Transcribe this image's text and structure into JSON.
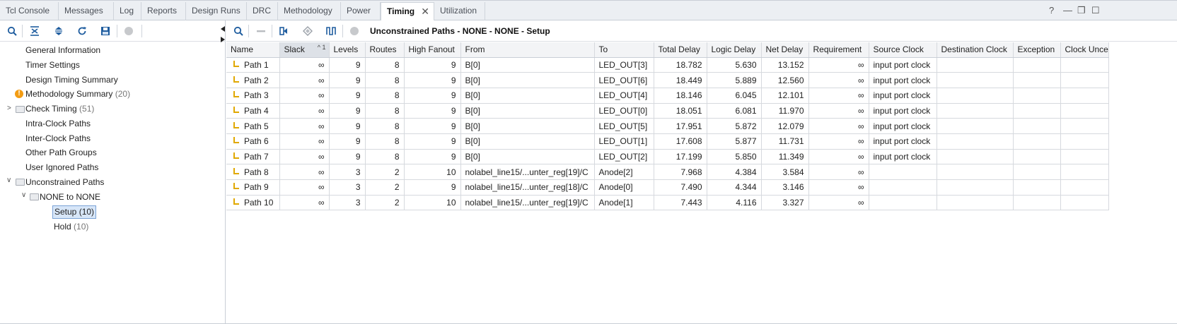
{
  "tabs": [
    {
      "label": "Tcl Console"
    },
    {
      "label": "Messages"
    },
    {
      "label": "Log"
    },
    {
      "label": "Reports"
    },
    {
      "label": "Design Runs"
    },
    {
      "label": "DRC"
    },
    {
      "label": "Methodology"
    },
    {
      "label": "Power"
    },
    {
      "label": "Timing"
    },
    {
      "label": "Utilization"
    }
  ],
  "active_tab": "Timing",
  "window_controls": {
    "help": "?",
    "minimize": "—",
    "restore": "❐",
    "maximize": "☐"
  },
  "tree": {
    "general_information": "General Information",
    "timer_settings": "Timer Settings",
    "design_timing_summary": "Design Timing Summary",
    "methodology_summary": "Methodology Summary",
    "methodology_summary_count": "(20)",
    "check_timing": "Check Timing",
    "check_timing_count": "(51)",
    "intra_clock_paths": "Intra-Clock Paths",
    "inter_clock_paths": "Inter-Clock Paths",
    "other_path_groups": "Other Path Groups",
    "user_ignored_paths": "User Ignored Paths",
    "unconstrained_paths": "Unconstrained Paths",
    "none_to_none": "NONE to NONE",
    "setup": "Setup (10)",
    "hold": "Hold",
    "hold_count": "(10)"
  },
  "panel_title": "Unconstrained Paths - NONE - NONE - Setup",
  "table": {
    "sort_indicator": "^ 1",
    "columns": [
      "Name",
      "Slack",
      "Levels",
      "Routes",
      "High Fanout",
      "From",
      "To",
      "Total Delay",
      "Logic Delay",
      "Net Delay",
      "Requirement",
      "Source Clock",
      "Destination Clock",
      "Exception",
      "Clock Unce"
    ],
    "rows": [
      [
        "Path 1",
        "∞",
        "9",
        "8",
        "9",
        "B[0]",
        "LED_OUT[3]",
        "18.782",
        "5.630",
        "13.152",
        "∞",
        "input port clock",
        "",
        "",
        ""
      ],
      [
        "Path 2",
        "∞",
        "9",
        "8",
        "9",
        "B[0]",
        "LED_OUT[6]",
        "18.449",
        "5.889",
        "12.560",
        "∞",
        "input port clock",
        "",
        "",
        ""
      ],
      [
        "Path 3",
        "∞",
        "9",
        "8",
        "9",
        "B[0]",
        "LED_OUT[4]",
        "18.146",
        "6.045",
        "12.101",
        "∞",
        "input port clock",
        "",
        "",
        ""
      ],
      [
        "Path 4",
        "∞",
        "9",
        "8",
        "9",
        "B[0]",
        "LED_OUT[0]",
        "18.051",
        "6.081",
        "11.970",
        "∞",
        "input port clock",
        "",
        "",
        ""
      ],
      [
        "Path 5",
        "∞",
        "9",
        "8",
        "9",
        "B[0]",
        "LED_OUT[5]",
        "17.951",
        "5.872",
        "12.079",
        "∞",
        "input port clock",
        "",
        "",
        ""
      ],
      [
        "Path 6",
        "∞",
        "9",
        "8",
        "9",
        "B[0]",
        "LED_OUT[1]",
        "17.608",
        "5.877",
        "11.731",
        "∞",
        "input port clock",
        "",
        "",
        ""
      ],
      [
        "Path 7",
        "∞",
        "9",
        "8",
        "9",
        "B[0]",
        "LED_OUT[2]",
        "17.199",
        "5.850",
        "11.349",
        "∞",
        "input port clock",
        "",
        "",
        ""
      ],
      [
        "Path 8",
        "∞",
        "3",
        "2",
        "10",
        "nolabel_line15/...unter_reg[19]/C",
        "Anode[2]",
        "7.968",
        "4.384",
        "3.584",
        "∞",
        "",
        "",
        "",
        ""
      ],
      [
        "Path 9",
        "∞",
        "3",
        "2",
        "9",
        "nolabel_line15/...unter_reg[18]/C",
        "Anode[0]",
        "7.490",
        "4.344",
        "3.146",
        "∞",
        "",
        "",
        "",
        ""
      ],
      [
        "Path 10",
        "∞",
        "3",
        "2",
        "10",
        "nolabel_line15/...unter_reg[19]/C",
        "Anode[1]",
        "7.443",
        "4.116",
        "3.327",
        "∞",
        "",
        "",
        "",
        ""
      ]
    ]
  },
  "colors": {
    "accent": "#1f5d9f",
    "path_icon": "#e0a800",
    "warning": "#f39c12",
    "selection": "#d7e6f8"
  }
}
